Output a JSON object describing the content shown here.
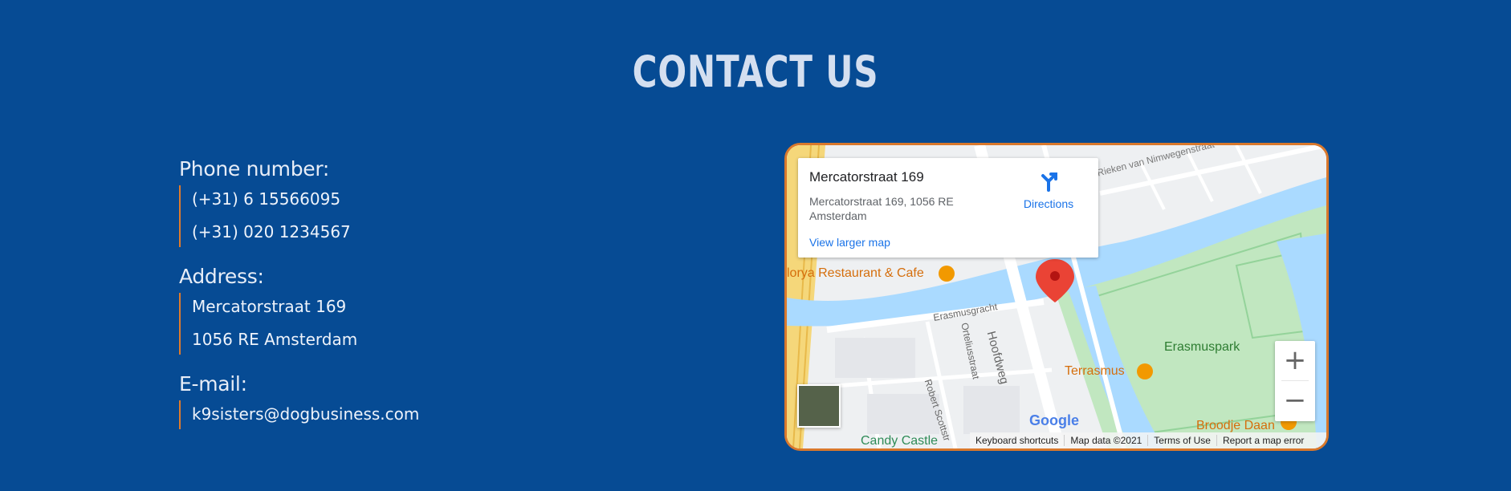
{
  "heading": "CONTACT US",
  "contact": {
    "phone_label": "Phone number:",
    "phones": [
      "(+31) 6 15566095",
      "(+31) 020 1234567"
    ],
    "address_label": "Address:",
    "address_lines": [
      "Mercatorstraat 169",
      "1056 RE Amsterdam"
    ],
    "email_label": "E-mail:",
    "email": "k9sisters@dogbusiness.com"
  },
  "map": {
    "place_title": "Mercatorstraat 169",
    "place_address": "Mercatorstraat 169, 1056 RE Amsterdam",
    "view_larger": "View larger map",
    "directions": "Directions",
    "zoom_in": "+",
    "zoom_out": "−",
    "labels": {
      "restaurant": "lorya Restaurant & Cafe",
      "erasmusgracht": "Erasmusgracht",
      "hoofdweg": "Hoofdweg",
      "ortelius": "Orteliusstraat",
      "robert": "Robert Scottstr",
      "erasmuspark": "Erasmuspark",
      "terrasmus": "Terrasmus",
      "broodje": "Broodje Daan",
      "candy": "Candy Castle",
      "nimwegen": "Rieken van Nimwegenstraat",
      "google": "Google"
    },
    "footer": {
      "shortcuts": "Keyboard shortcuts",
      "mapdata": "Map data ©2021",
      "terms": "Terms of Use",
      "report": "Report a map error"
    }
  },
  "colors": {
    "background": "#064b94",
    "accent": "#e07b2a",
    "link": "#1a73e8",
    "water": "#aadaff",
    "park": "#c1e7c0"
  }
}
